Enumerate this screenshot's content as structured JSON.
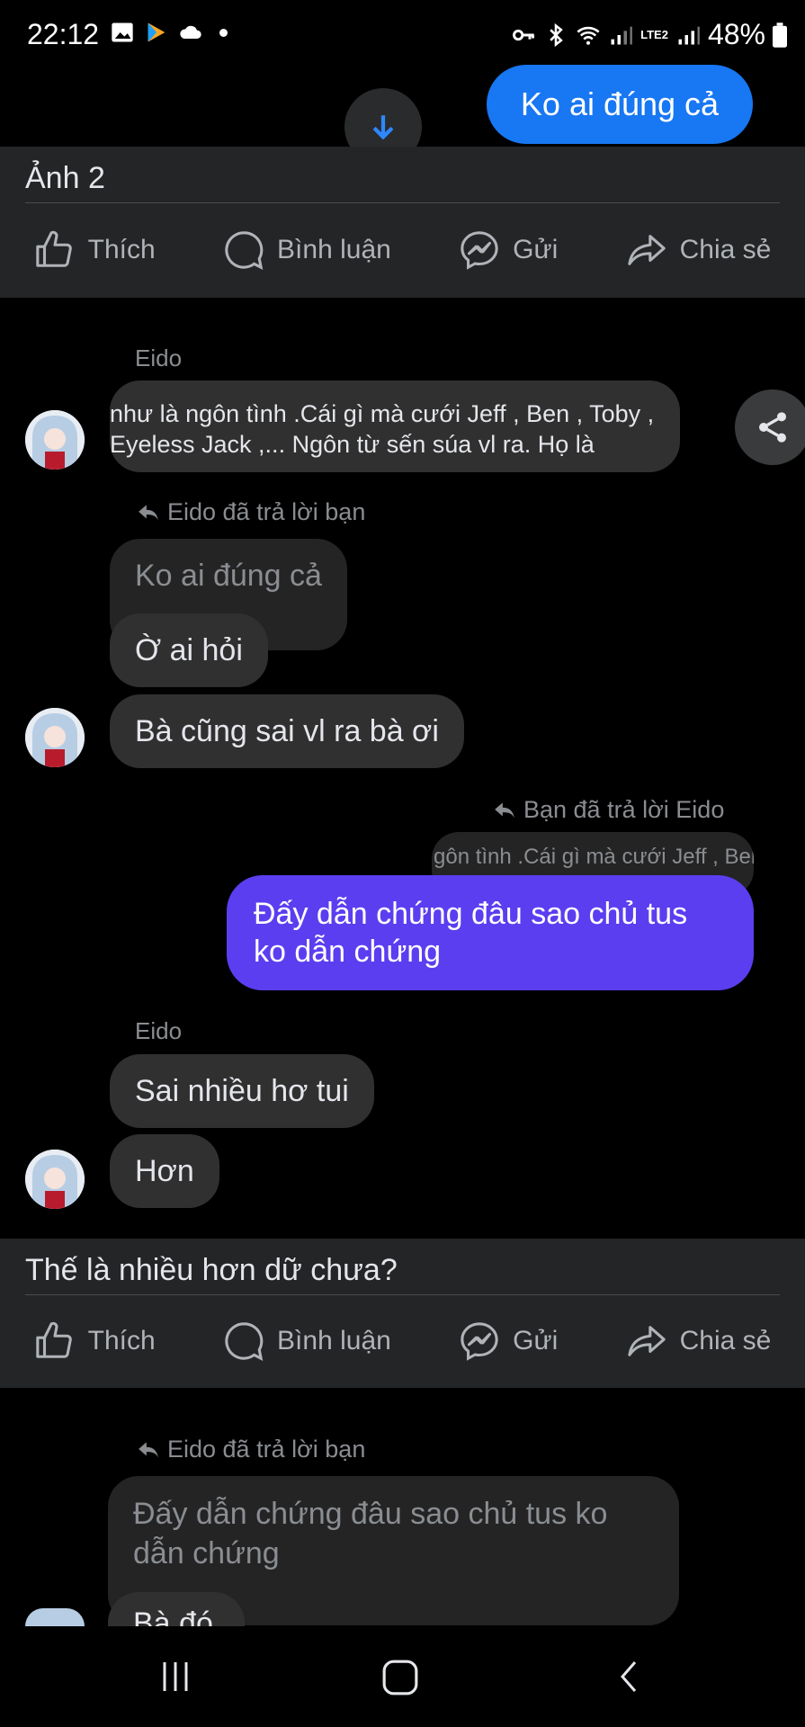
{
  "status_bar": {
    "time": "22:12",
    "battery": "48%",
    "network_label": "LTE2"
  },
  "top_bubble": {
    "text": "Ko ai đúng cả"
  },
  "post1": {
    "caption": "Ảnh 2",
    "actions": {
      "like": "Thích",
      "comment": "Bình luận",
      "send": "Gửi",
      "share": "Chia sẻ"
    }
  },
  "chat": {
    "sender1": "Eido",
    "long_text_lines": [
      "như là ngôn tình .Cái gì mà cưới Jeff , Ben , Toby ,",
      "Eyeless Jack ,... Ngôn từ sến súa vl ra. Họ là"
    ],
    "reply1_meta": "Eido đã trả lời bạn",
    "quote1": "Ko ai đúng cả",
    "msg_o_ai_hoi": "Ờ ai hỏi",
    "msg_ba_cung_sai": "Bà cũng sai vl ra bà ơi",
    "reply2_meta": "Bạn đã trả lời Eido",
    "quote2": "gôn tình .Cái gì mà cưới Jeff , Ben",
    "out_msg": "Đấy dẫn chứng đâu sao chủ tus ko dẫn chứng",
    "sender2": "Eido",
    "msg_sai_nhieu": "Sai nhiều hơ tui",
    "msg_hon": "Hơn"
  },
  "post2": {
    "caption": "Thế là nhiều hơn dữ chưa?",
    "actions": {
      "like": "Thích",
      "comment": "Bình luận",
      "send": "Gửi",
      "share": "Chia sẻ"
    }
  },
  "chat_bottom": {
    "reply3_meta": "Eido đã trả lời bạn",
    "quote3": "Đấy dẫn chứng đâu sao chủ tus ko dẫn chứng",
    "partial_msg": "Bà đó"
  },
  "colors": {
    "accent_blue": "#1877f2",
    "out_bubble": "#5b3ef0",
    "card_bg": "#242526"
  }
}
